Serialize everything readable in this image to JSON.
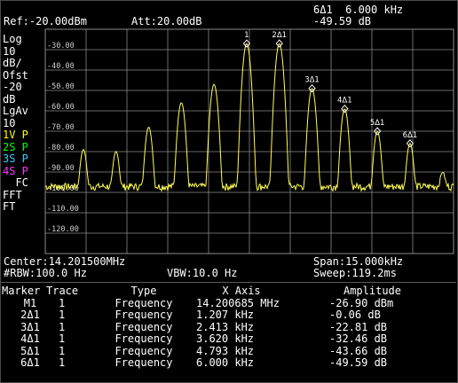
{
  "header": {
    "ref": "Ref:-20.00dBm",
    "att": "Att:20.00dB",
    "marker_readout": "6Δ1  6.000 kHz",
    "marker_value": "-49.59 dB"
  },
  "sidebar": {
    "items": [
      {
        "label": "Log",
        "color": "#ffffff"
      },
      {
        "label": "10",
        "color": "#ffffff"
      },
      {
        "label": "dB/",
        "color": "#ffffff"
      },
      {
        "label": "Ofst",
        "color": "#ffffff"
      },
      {
        "label": "-20",
        "color": "#ffffff"
      },
      {
        "label": "dB",
        "color": "#ffffff"
      },
      {
        "label": "LgAv",
        "color": "#ffffff"
      },
      {
        "label": "10",
        "color": "#ffffff"
      },
      {
        "label": "1V P",
        "color": "#ffff00"
      },
      {
        "label": "2S P",
        "color": "#00ff00"
      },
      {
        "label": "3S P",
        "color": "#33ccff"
      },
      {
        "label": "4S P",
        "color": "#ff33ff"
      },
      {
        "label": "  FC",
        "color": "#ffffff"
      },
      {
        "label": "FFT",
        "color": "#ffffff"
      },
      {
        "label": "FT",
        "color": "#ffffff"
      }
    ]
  },
  "footer": {
    "center": "Center:14.201500MHz",
    "span": "Span:15.000kHz",
    "rbw": "#RBW:100.0 Hz",
    "vbw": "VBW:10.0 Hz",
    "sweep": "Sweep:119.2ms"
  },
  "marker_table": {
    "headers": [
      "Marker",
      "Trace",
      "Type",
      "X Axis",
      "Amplitude"
    ],
    "rows": [
      {
        "marker": "M1",
        "trace": "1",
        "type": "Frequency",
        "x": "14.200685 MHz",
        "amp": "-26.90 dBm"
      },
      {
        "marker": "2Δ1",
        "trace": "1",
        "type": "Frequency",
        "x": "1.207 kHz",
        "amp": "-0.06 dB"
      },
      {
        "marker": "3Δ1",
        "trace": "1",
        "type": "Frequency",
        "x": "2.413 kHz",
        "amp": "-22.81 dB"
      },
      {
        "marker": "4Δ1",
        "trace": "1",
        "type": "Frequency",
        "x": "3.620 kHz",
        "amp": "-32.46 dB"
      },
      {
        "marker": "5Δ1",
        "trace": "1",
        "type": "Frequency",
        "x": "4.793 kHz",
        "amp": "-43.66 dB"
      },
      {
        "marker": "6Δ1",
        "trace": "1",
        "type": "Frequency",
        "x": "6.000 kHz",
        "amp": "-49.59 dB"
      }
    ]
  },
  "colors": {
    "trace": "#ffff55",
    "grid": "#8a8a8a",
    "marker": "#ffffff"
  },
  "chart_data": {
    "type": "line",
    "title": "",
    "xlabel": "",
    "ylabel": "",
    "x_unit": "kHz offset from center",
    "xlim": [
      -7.5,
      7.5
    ],
    "ylim": [
      -130,
      -20
    ],
    "y_ticks": [
      "-30.00",
      "-40.00",
      "-50.00",
      "-60.00",
      "-70.00",
      "-80.00",
      "-90.00",
      "-100.00",
      "-110.00",
      "-120.00"
    ],
    "y_tick_values": [
      -30,
      -40,
      -50,
      -60,
      -70,
      -80,
      -90,
      -100,
      -110,
      -120
    ],
    "noise_floor": -97,
    "grid": true,
    "peaks": [
      {
        "x": -6.1,
        "y": -79
      },
      {
        "x": -4.9,
        "y": -80
      },
      {
        "x": -3.7,
        "y": -68
      },
      {
        "x": -2.5,
        "y": -56
      },
      {
        "x": -1.3,
        "y": -47
      },
      {
        "x": -0.1,
        "y": -27
      },
      {
        "x": 1.1,
        "y": -27
      },
      {
        "x": 2.3,
        "y": -49
      },
      {
        "x": 3.5,
        "y": -59
      },
      {
        "x": 4.7,
        "y": -70
      },
      {
        "x": 5.9,
        "y": -76
      },
      {
        "x": 7.1,
        "y": -91
      }
    ],
    "markers": [
      {
        "label": "1",
        "x": -0.1,
        "y": -27
      },
      {
        "label": "2Δ1",
        "x": 1.1,
        "y": -27
      },
      {
        "label": "3Δ1",
        "x": 2.3,
        "y": -49
      },
      {
        "label": "4Δ1",
        "x": 3.5,
        "y": -59
      },
      {
        "label": "5Δ1",
        "x": 4.7,
        "y": -70
      },
      {
        "label": "6Δ1",
        "x": 5.9,
        "y": -76
      }
    ]
  }
}
